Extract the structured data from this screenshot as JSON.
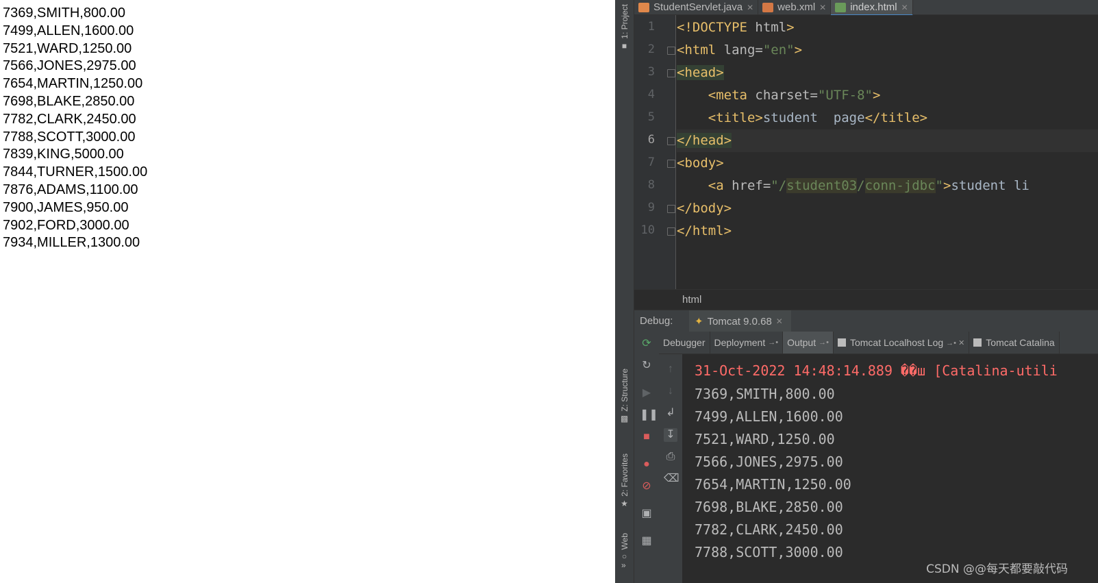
{
  "browser_output": {
    "lines": [
      "7369,SMITH,800.00",
      "7499,ALLEN,1600.00",
      "7521,WARD,1250.00",
      "7566,JONES,2975.00",
      "7654,MARTIN,1250.00",
      "7698,BLAKE,2850.00",
      "7782,CLARK,2450.00",
      "7788,SCOTT,3000.00",
      "7839,KING,5000.00",
      "7844,TURNER,1500.00",
      "7876,ADAMS,1100.00",
      "7900,JAMES,950.00",
      "7902,FORD,3000.00",
      "7934,MILLER,1300.00"
    ]
  },
  "ide": {
    "side_tabs": {
      "project": "1: Project",
      "structure": "Z: Structure",
      "favorites": "2: Favorites",
      "web": "Web"
    },
    "editor_tabs": [
      {
        "label": "StudentServlet.java",
        "icon_color": "#e0884b",
        "active": false
      },
      {
        "label": "web.xml",
        "icon_color": "#d47845",
        "active": false
      },
      {
        "label": "index.html",
        "icon_color": "#6a9b5a",
        "active": true
      }
    ],
    "line_numbers": [
      "1",
      "2",
      "3",
      "4",
      "5",
      "6",
      "7",
      "8",
      "9",
      "10"
    ],
    "current_line": "6",
    "code": {
      "l1": {
        "open": "<!DOCTYPE",
        "rest": " html",
        "close": ">"
      },
      "l2": {
        "open": "<html",
        "attr": " lang=",
        "val": "\"en\"",
        "close": ">"
      },
      "l3": {
        "tag": "<head>"
      },
      "l4": {
        "indent": "    ",
        "open": "<meta",
        "attr": " charset=",
        "val": "\"UTF-8\"",
        "close": ">"
      },
      "l5": {
        "indent": "    ",
        "open": "<title>",
        "text": "student  page",
        "close": "</title>"
      },
      "l6": {
        "tag": "</head>"
      },
      "l7": {
        "tag": "<body>"
      },
      "l8": {
        "indent": "    ",
        "open": "<a",
        "attr": " href=",
        "q1": "\"/",
        "p1": "student03",
        "slash": "/",
        "p2": "conn-jdbc",
        "q2": "\"",
        "close": ">",
        "text": "student li"
      },
      "l9": {
        "tag": "</body>"
      },
      "l10": {
        "tag": "</html>"
      }
    },
    "breadcrumb": "html",
    "debug": {
      "label": "Debug:",
      "config": "Tomcat 9.0.68",
      "config_icon": "tomcat-icon",
      "tabs": [
        "Debugger",
        "Deployment",
        "Output",
        "Tomcat Localhost Log",
        "Tomcat Catalina"
      ],
      "active_tab": "Output"
    },
    "console": {
      "log_line": "31-Oct-2022 14:48:14.889 ��ш [Catalina-utili",
      "lines": [
        "7369,SMITH,800.00",
        "7499,ALLEN,1600.00",
        "7521,WARD,1250.00",
        "7566,JONES,2975.00",
        "7654,MARTIN,1250.00",
        "7698,BLAKE,2850.00",
        "7782,CLARK,2450.00",
        "7788,SCOTT,3000.00"
      ]
    },
    "colors": {
      "tag": "#e8bf6a",
      "string": "#6a8759",
      "error": "#ff6b68",
      "background": "#2b2b2b"
    }
  },
  "watermark": "CSDN @@每天都要敲代码"
}
